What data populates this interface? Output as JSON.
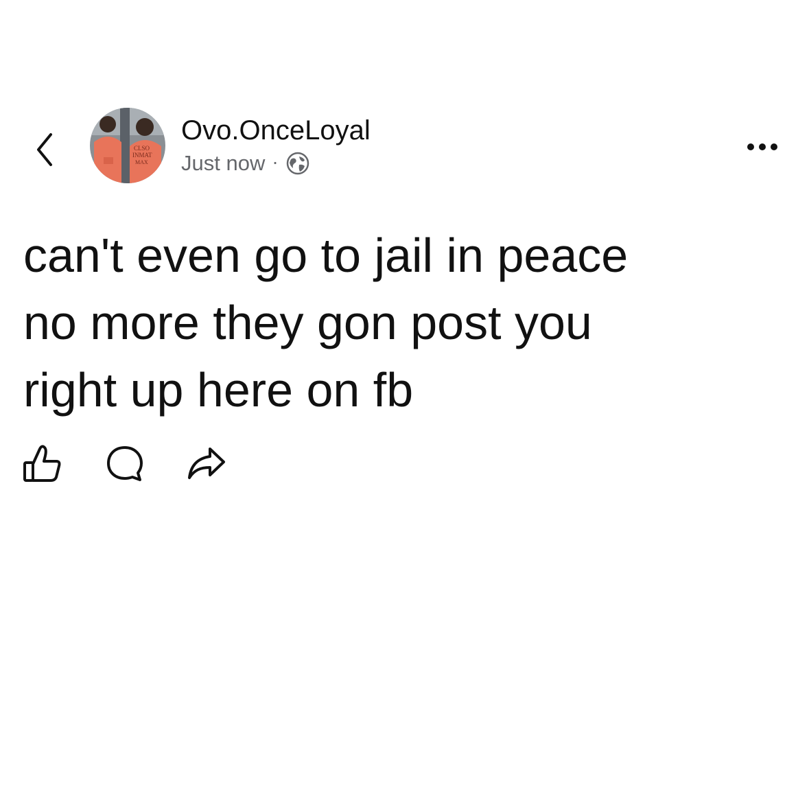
{
  "header": {
    "back_icon": "chevron-left-icon",
    "author_name": "Ovo.OnceLoyal",
    "timestamp": "Just now",
    "separator": "·",
    "audience_icon": "globe-icon",
    "more_icon": "more-horizontal-icon"
  },
  "post": {
    "lines": [
      "can't even go to jail in peace",
      "no more they gon post you",
      "right up here on fb"
    ]
  },
  "actions": {
    "like_icon": "thumbs-up-icon",
    "comment_icon": "comment-bubble-icon",
    "share_icon": "share-arrow-icon"
  },
  "colors": {
    "text": "#111111",
    "secondary_text": "#65676b",
    "background": "#ffffff",
    "avatar_jumpsuit": "#e8745a"
  }
}
